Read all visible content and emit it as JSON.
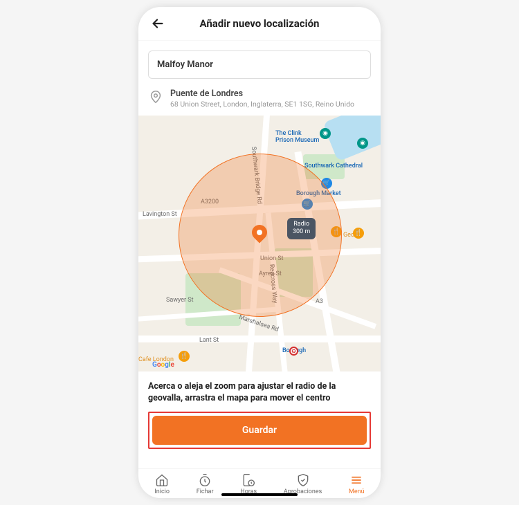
{
  "header": {
    "title": "Añadir nuevo localización"
  },
  "form": {
    "name_value": "Malfoy Manor",
    "location_name": "Puente de Londres",
    "location_address": "68 Union Street, London, Inglaterra, SE1 1SG, Reino Unido"
  },
  "map": {
    "radius_label": "Radio",
    "radius_value": "300 m",
    "labels": {
      "lavington": "Lavington St",
      "union": "Union St",
      "southwark_br": "Southwark Bridge Rd",
      "redcross": "Redcross Way",
      "ayres": "Ayres St",
      "marshalsea": "Marshalsea Rd",
      "lant": "Lant St",
      "a3200": "A3200",
      "a3": "A3",
      "sawyer": "Sawyer St",
      "clink": "The Clink\nPrison Museum",
      "southwark_cath": "Southwark Cathedral",
      "borough_market": "Borough Market",
      "borough": "Borough",
      "george": "George",
      "cafe_london": "Cafe London"
    }
  },
  "help": "Acerca o aleja el zoom para ajustar el radio de la geovalla, arrastra el mapa para mover el centro",
  "save_label": "Guardar",
  "tabs": {
    "inicio": "Inicio",
    "fichar": "Fichar",
    "horas": "Horas",
    "aprobaciones": "Aprobaciones",
    "menu": "Menú"
  }
}
